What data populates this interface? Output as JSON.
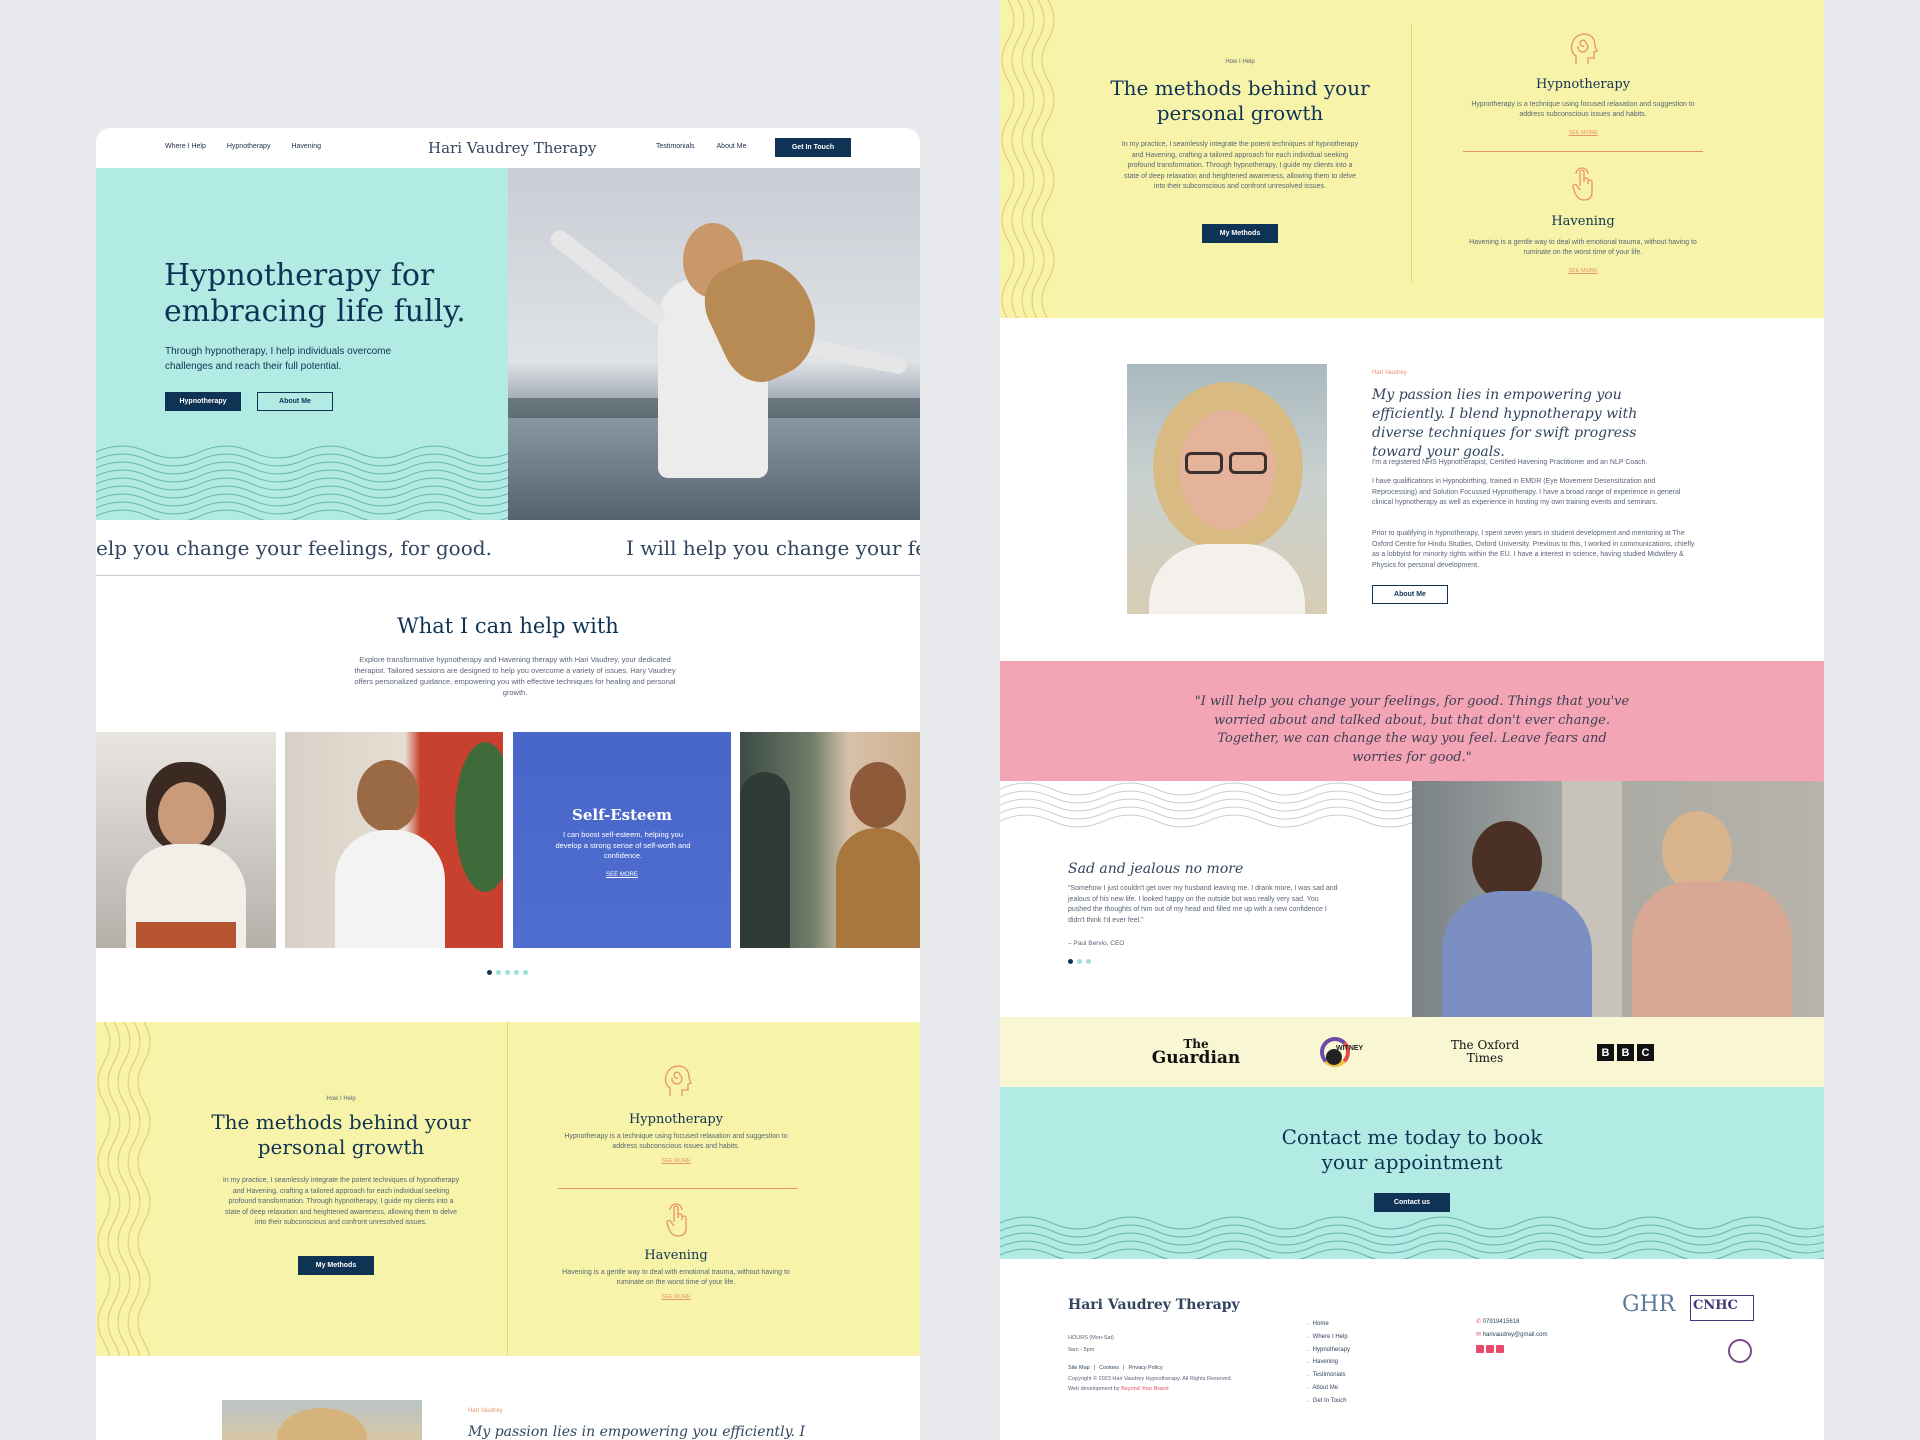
{
  "nav": {
    "left": [
      "Where I Help",
      "Hypnotherapy",
      "Havening"
    ],
    "logo": "Hari Vaudrey Therapy",
    "right": [
      "Testimonials",
      "About Me"
    ],
    "cta": "Get In Touch"
  },
  "hero": {
    "title_line1": "Hypnotherapy for",
    "title_line2": "embracing life fully.",
    "subtitle_line1": "Through hypnotherapy, I help individuals overcome",
    "subtitle_line2": "challenges and reach their full potential.",
    "btn1": "Hypnotherapy",
    "btn2": "About Me"
  },
  "ticker": {
    "left": "elp you change your feelings, for good.",
    "right": "I will help you change your fee"
  },
  "help": {
    "title": "What I can help with",
    "desc": "Explore transformative hypnotherapy and Havening therapy with Hari Vaudrey, your dedicated therapist. Tailored sessions are designed to help you overcome a variety of issues. Hary Vaudrey offers personalized guidance, empowering you with effective techniques for healing and personal growth.",
    "card_title": "Self-Esteem",
    "card_desc": "I can boost self-esteem, helping you develop a strong sense of self-worth and confidence.",
    "card_link": "SEE MORE"
  },
  "methods": {
    "eyebrow": "How I Help",
    "title_line1": "The methods behind your",
    "title_line2": "personal growth",
    "desc": "In my practice, I seamlessly integrate the potent techniques of hypnotherapy and Havening, crafting a tailored approach for each individual seeking profound transformation. Through hypnotherapy, I guide my clients into a state of deep relaxation and heightened awareness, allowing them to delve into their subconscious and confront unresolved issues.",
    "btn": "My Methods",
    "m1_title": "Hypnotherapy",
    "m1_desc": "Hypnotherapy is a technique using focused relaxation and suggestion to address subconscious issues and habits.",
    "m2_title": "Havening",
    "m2_desc": "Havening is a gentle way to deal with emotional trauma, without having to ruminate on the worst time of your life.",
    "see_more": "SEE MORE"
  },
  "about": {
    "eyebrow": "Hari Vaudrey",
    "title": "My passion lies in empowering you efficiently. I blend hypnotherapy with diverse techniques for swift progress toward your goals.",
    "title_partial": "My passion lies in empowering you efficiently. I",
    "p1": "I'm a registered NHS Hypnotherapist, Certified Havening Practitioner and an NLP Coach.",
    "p2": "I have qualifications in Hypnobirthing, trained in EMDR (Eye Movement Desensitization and Reprocessing) and Solution Focussed Hypnotherapy. I have a broad range of experience in general clinical hypnotherapy as well as experience in hosting my own training events and seminars.",
    "p3": "Prior to qualifying in hypnotherapy, I spent seven years in student development and mentoring at The Oxford Centre for Hindu Studies, Oxford University. Previous to this, I worked in communications, chiefly as a lobbyist for minority rights within the EU. I have a interest in science, having studied Midwifery & Physics for personal development.",
    "btn": "About Me"
  },
  "quote": {
    "text": "\"I will help you change your feelings, for good. Things that you've worried about and talked about, but that don't ever change. Together, we can change the way you feel. Leave fears and worries for good.\""
  },
  "testimonial": {
    "title": "Sad and jealous no more",
    "text": "\"Somehow I just couldn't get over my husband leaving me. I drank more, I was sad and jealous of his new life. I looked happy on the outside but was really very sad. You pushed the thoughts of him out of my head and filled me up with a new confidence I didn't think I'd ever feel.\"",
    "author": "– Paul Bervio, CEO"
  },
  "press": {
    "guardian1": "The",
    "guardian2": "Guardian",
    "witney": "WITNEY",
    "oxford1": "The Oxford",
    "oxford2": "Times",
    "bbc": [
      "B",
      "B",
      "C"
    ]
  },
  "contact": {
    "title_line1": "Contact me today to book",
    "title_line2": "your appointment",
    "btn": "Contact us"
  },
  "footer": {
    "logo": "Hari Vaudrey Therapy",
    "hours_label": "HOURS (Mon-Sat)",
    "hours": "9am - 5pm",
    "links_legal": [
      "Site Map",
      "Cookies",
      "Privacy Policy"
    ],
    "copyright": "Copyright © 2023 Hari Vaudrey Hypnotherapy. All Rights Reserved.",
    "webdev": "Web development by",
    "webdev_link": "Beyond Your Brand",
    "menu": [
      "Home",
      "Where I Help",
      "Hypnotherapy",
      "Havening",
      "Testimonials",
      "About Me",
      "Get In Touch"
    ],
    "phone": "07919415618",
    "email": "harivaudrey@gmail.com",
    "ghr": "GHR",
    "cnhc": "CNHC"
  },
  "colors": {
    "navy": "#0f3355",
    "mint": "#b2ebe3",
    "yellow": "#f7f3a8",
    "pink": "#f3a5b5",
    "accent": "#e8926a"
  }
}
